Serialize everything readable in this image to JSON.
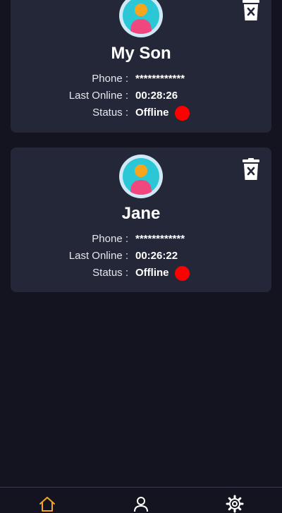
{
  "contacts": [
    {
      "name": "My Son",
      "phone_label": "Phone :",
      "phone": "************",
      "last_online_label": "Last Online :",
      "last_online": "00:28:26",
      "status_label": "Status :",
      "status": "Offline",
      "status_color": "#ff0000"
    },
    {
      "name": "Jane",
      "phone_label": "Phone :",
      "phone": "************",
      "last_online_label": "Last Online :",
      "last_online": "00:26:22",
      "status_label": "Status :",
      "status": "Offline",
      "status_color": "#ff0000"
    }
  ],
  "icons": {
    "avatar": "avatar-icon",
    "delete": "trash-icon",
    "nav": [
      "home-icon",
      "profile-icon",
      "settings-icon"
    ]
  },
  "colors": {
    "background": "#13141f",
    "card": "#232738",
    "accent": "#f5a623",
    "offline": "#ff0000"
  }
}
